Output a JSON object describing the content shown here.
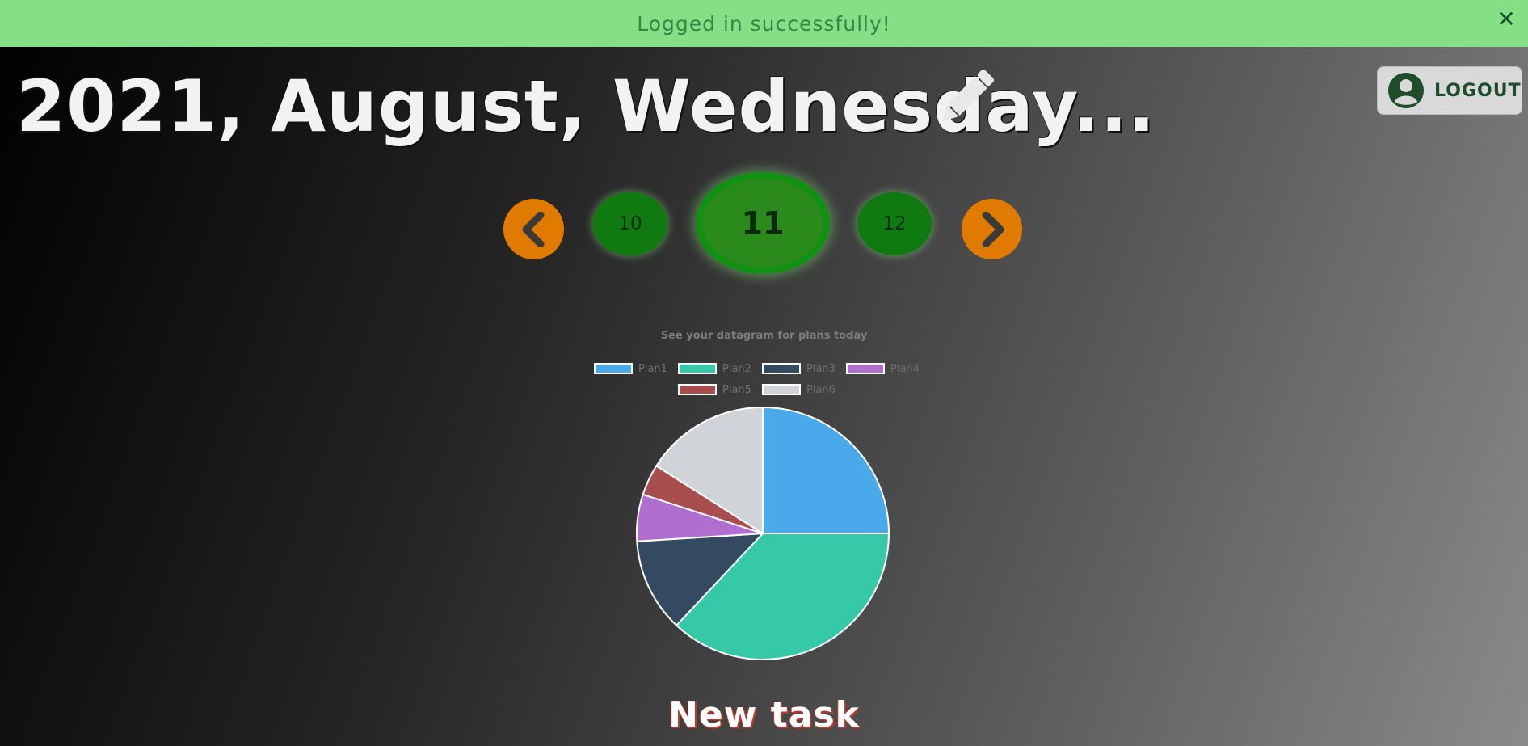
{
  "banner": {
    "message": "Logged in successfully!",
    "close_symbol": "✕",
    "close_icon": "close-icon",
    "background": "#85e085",
    "text_color": "#2e8b46"
  },
  "header": {
    "title": "2021, August, Wednesday...",
    "edit_icon": "pencil-icon",
    "logout_label": "LOGOUT",
    "logout_icon": "user-circle-icon"
  },
  "day_nav": {
    "prev_icon": "chevron-left-icon",
    "next_icon": "chevron-right-icon",
    "days": [
      {
        "label": "10",
        "current": false
      },
      {
        "label": "11",
        "current": true
      },
      {
        "label": "12",
        "current": false
      }
    ],
    "arrow_color": "#e07b00",
    "day_color": "#0f7a0f"
  },
  "chart_data": {
    "type": "pie",
    "title": "See your datagram for plans today",
    "legend_position": "top",
    "labels": [
      "Plan1",
      "Plan2",
      "Plan3",
      "Plan4",
      "Plan5",
      "Plan6"
    ],
    "values": [
      25,
      37,
      12,
      6,
      4,
      16
    ],
    "colors": [
      "#4aa9ea",
      "#35c9a8",
      "#344a60",
      "#b06ecf",
      "#a84e4e",
      "#d0d4d8"
    ]
  },
  "footer": {
    "new_task_label": "New task"
  }
}
